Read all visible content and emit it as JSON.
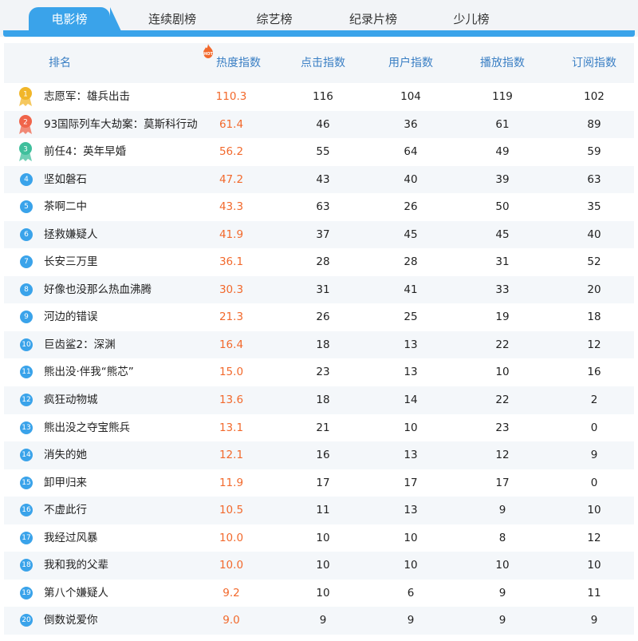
{
  "tabs": [
    {
      "label": "电影榜",
      "active": true
    },
    {
      "label": "连续剧榜",
      "active": false
    },
    {
      "label": "综艺榜",
      "active": false
    },
    {
      "label": "纪录片榜",
      "active": false
    },
    {
      "label": "少儿榜",
      "active": false
    }
  ],
  "columns": {
    "rank": "排名",
    "heat": "热度指数",
    "clicks": "点击指数",
    "users": "用户指数",
    "plays": "播放指数",
    "subs": "订阅指数"
  },
  "hot_badge": "HOT",
  "colors": {
    "accent": "#3aa3ea",
    "heat": "#f2692c",
    "header_text": "#3a7fc4",
    "gold": "#f1b629",
    "red": "#f0644a",
    "green": "#3fbf9c"
  },
  "rows": [
    {
      "rank": "1",
      "name": "志愿军：雄兵出击",
      "heat": "110.3",
      "clicks": "116",
      "users": "104",
      "plays": "119",
      "subs": "102"
    },
    {
      "rank": "2",
      "name": "93国际列车大劫案：莫斯科行动",
      "heat": "61.4",
      "clicks": "46",
      "users": "36",
      "plays": "61",
      "subs": "89"
    },
    {
      "rank": "3",
      "name": "前任4：英年早婚",
      "heat": "56.2",
      "clicks": "55",
      "users": "64",
      "plays": "49",
      "subs": "59"
    },
    {
      "rank": "4",
      "name": "坚如磐石",
      "heat": "47.2",
      "clicks": "43",
      "users": "40",
      "plays": "39",
      "subs": "63"
    },
    {
      "rank": "5",
      "name": "茶啊二中",
      "heat": "43.3",
      "clicks": "63",
      "users": "26",
      "plays": "50",
      "subs": "35"
    },
    {
      "rank": "6",
      "name": "拯救嫌疑人",
      "heat": "41.9",
      "clicks": "37",
      "users": "45",
      "plays": "45",
      "subs": "40"
    },
    {
      "rank": "7",
      "name": "长安三万里",
      "heat": "36.1",
      "clicks": "28",
      "users": "28",
      "plays": "31",
      "subs": "52"
    },
    {
      "rank": "8",
      "name": "好像也没那么热血沸腾",
      "heat": "30.3",
      "clicks": "31",
      "users": "41",
      "plays": "33",
      "subs": "20"
    },
    {
      "rank": "9",
      "name": "河边的错误",
      "heat": "21.3",
      "clicks": "26",
      "users": "25",
      "plays": "19",
      "subs": "18"
    },
    {
      "rank": "10",
      "name": "巨齿鲨2：深渊",
      "heat": "16.4",
      "clicks": "18",
      "users": "13",
      "plays": "22",
      "subs": "12"
    },
    {
      "rank": "11",
      "name": "熊出没·伴我“熊芯”",
      "heat": "15.0",
      "clicks": "23",
      "users": "13",
      "plays": "10",
      "subs": "16"
    },
    {
      "rank": "12",
      "name": "疯狂动物城",
      "heat": "13.6",
      "clicks": "18",
      "users": "14",
      "plays": "22",
      "subs": "2"
    },
    {
      "rank": "13",
      "name": "熊出没之夺宝熊兵",
      "heat": "13.1",
      "clicks": "21",
      "users": "10",
      "plays": "23",
      "subs": "0"
    },
    {
      "rank": "14",
      "name": "消失的她",
      "heat": "12.1",
      "clicks": "16",
      "users": "13",
      "plays": "12",
      "subs": "9"
    },
    {
      "rank": "15",
      "name": "卸甲归来",
      "heat": "11.9",
      "clicks": "17",
      "users": "17",
      "plays": "17",
      "subs": "0"
    },
    {
      "rank": "16",
      "name": "不虚此行",
      "heat": "10.5",
      "clicks": "11",
      "users": "13",
      "plays": "9",
      "subs": "10"
    },
    {
      "rank": "17",
      "name": "我经过风暴",
      "heat": "10.0",
      "clicks": "10",
      "users": "10",
      "plays": "8",
      "subs": "12"
    },
    {
      "rank": "18",
      "name": "我和我的父辈",
      "heat": "10.0",
      "clicks": "10",
      "users": "10",
      "plays": "10",
      "subs": "10"
    },
    {
      "rank": "19",
      "name": "第八个嫌疑人",
      "heat": "9.2",
      "clicks": "10",
      "users": "6",
      "plays": "9",
      "subs": "11"
    },
    {
      "rank": "20",
      "name": "倒数说爱你",
      "heat": "9.0",
      "clicks": "9",
      "users": "9",
      "plays": "9",
      "subs": "9"
    }
  ]
}
